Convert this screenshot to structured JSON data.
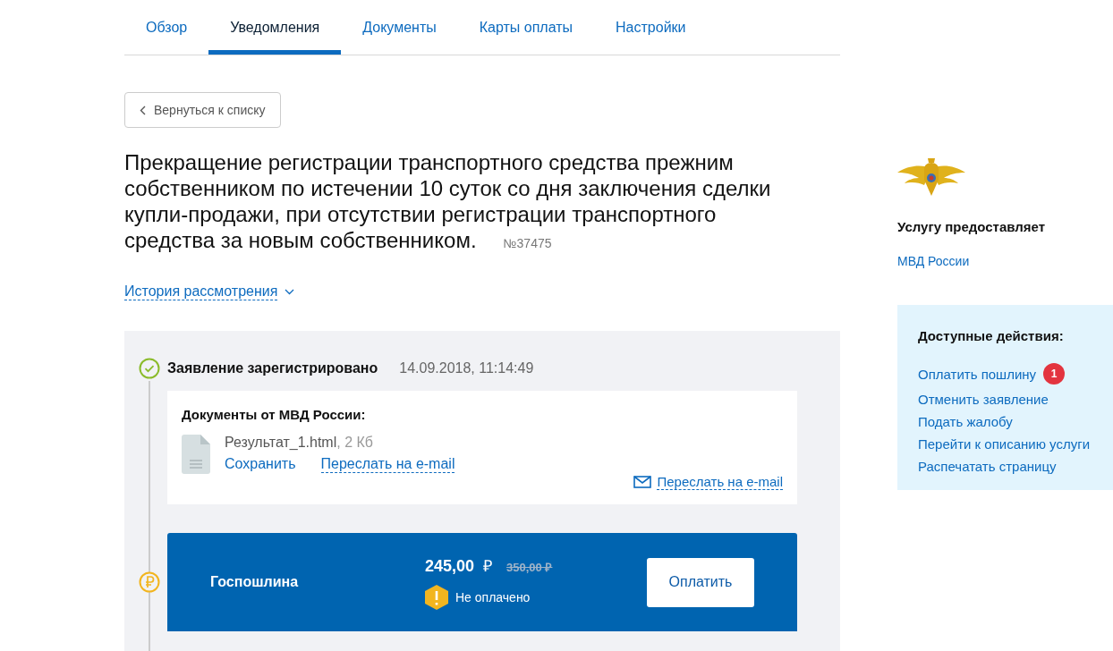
{
  "tabs": [
    {
      "label": "Обзор",
      "selected": false
    },
    {
      "label": "Уведомления",
      "selected": true
    },
    {
      "label": "Документы",
      "selected": false
    },
    {
      "label": "Карты оплаты",
      "selected": false
    },
    {
      "label": "Настройки",
      "selected": false
    }
  ],
  "back_button": "Вернуться к списку",
  "title": "Прекращение регистрации транспортного средства прежним собственником по истечении 10 суток со дня заключения сделки купли-продажи, при отсутствии регистрации транспортного средства за новым собственником.",
  "number": "№37475",
  "history_link": {
    "label": "История рассмотрения",
    "expanded": false
  },
  "timeline": [
    {
      "kind": "status",
      "title": "Заявление зарегистрировано",
      "date": "14.09.2018, 11:14:49",
      "documents": {
        "heading": "Документы от МВД России:",
        "files": [
          {
            "name": "Результат_1.html",
            "size": ", 2 Кб",
            "actions": [
              "Сохранить",
              "Переслать на e-mail"
            ]
          }
        ],
        "forward_link": "Переслать на e-mail"
      }
    },
    {
      "kind": "payment",
      "label": "Госпошлина",
      "price": "245,00",
      "currency": "₽",
      "old_price": "350,00 ₽",
      "status": "Не оплачено",
      "paid": false,
      "button": "Оплатить"
    }
  ],
  "sidebar": {
    "provider_heading": "Услугу предоставляет",
    "provider": "МВД России",
    "actions_heading": "Доступные действия:",
    "actions": [
      {
        "label": "Оплатить пошлину",
        "badge": "1"
      },
      {
        "label": "Отменить заявление"
      },
      {
        "label": "Подать жалобу"
      },
      {
        "label": "Перейти к описанию услуги"
      },
      {
        "label": "Распечатать страницу"
      }
    ]
  }
}
